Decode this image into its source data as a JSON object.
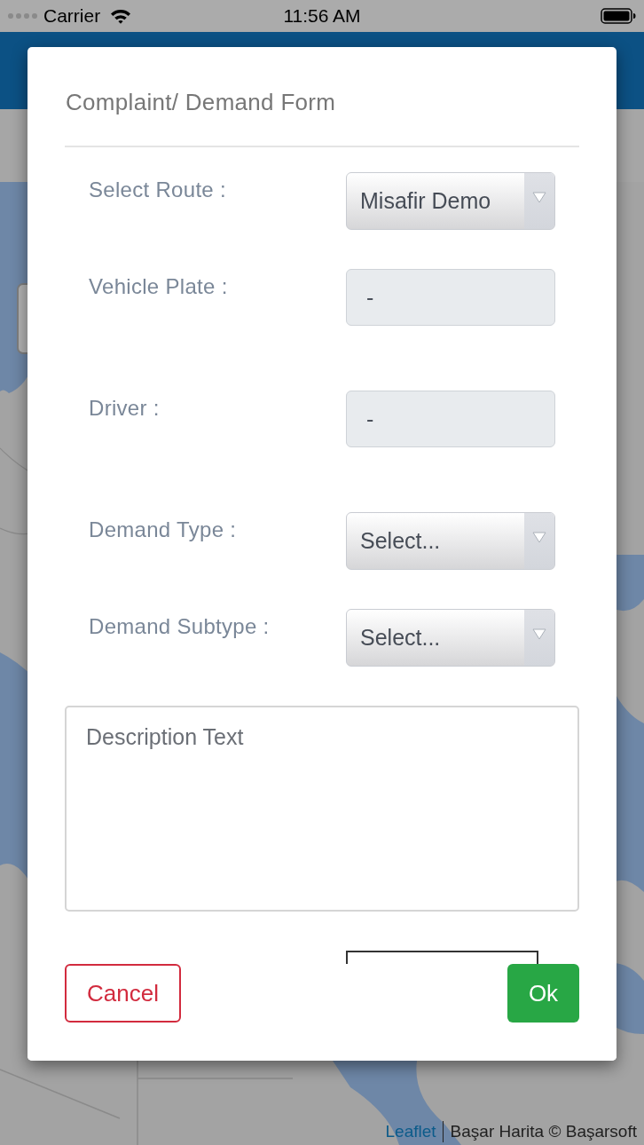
{
  "status_bar": {
    "carrier": "Carrier",
    "time": "11:56 AM"
  },
  "dialog": {
    "title": "Complaint/ Demand Form",
    "fields": [
      {
        "kind": "select",
        "label": "Select Route :",
        "value": "Misafir Demo"
      },
      {
        "kind": "readonly",
        "label": "Vehicle Plate :",
        "value": "-"
      },
      {
        "kind": "readonly",
        "label": "Driver :",
        "value": "-"
      },
      {
        "kind": "select",
        "label": "Demand Type :",
        "value": "Select..."
      },
      {
        "kind": "select",
        "label": "Demand Subtype :",
        "value": "Select..."
      }
    ],
    "description": {
      "placeholder": "Description Text"
    },
    "buttons": [
      {
        "kind": "cancel",
        "label": "Cancel"
      },
      {
        "kind": "ok",
        "label": "Ok"
      }
    ]
  },
  "map_attribution": {
    "link": "Leaflet",
    "text": "Başar Harita © Başarsoft"
  }
}
